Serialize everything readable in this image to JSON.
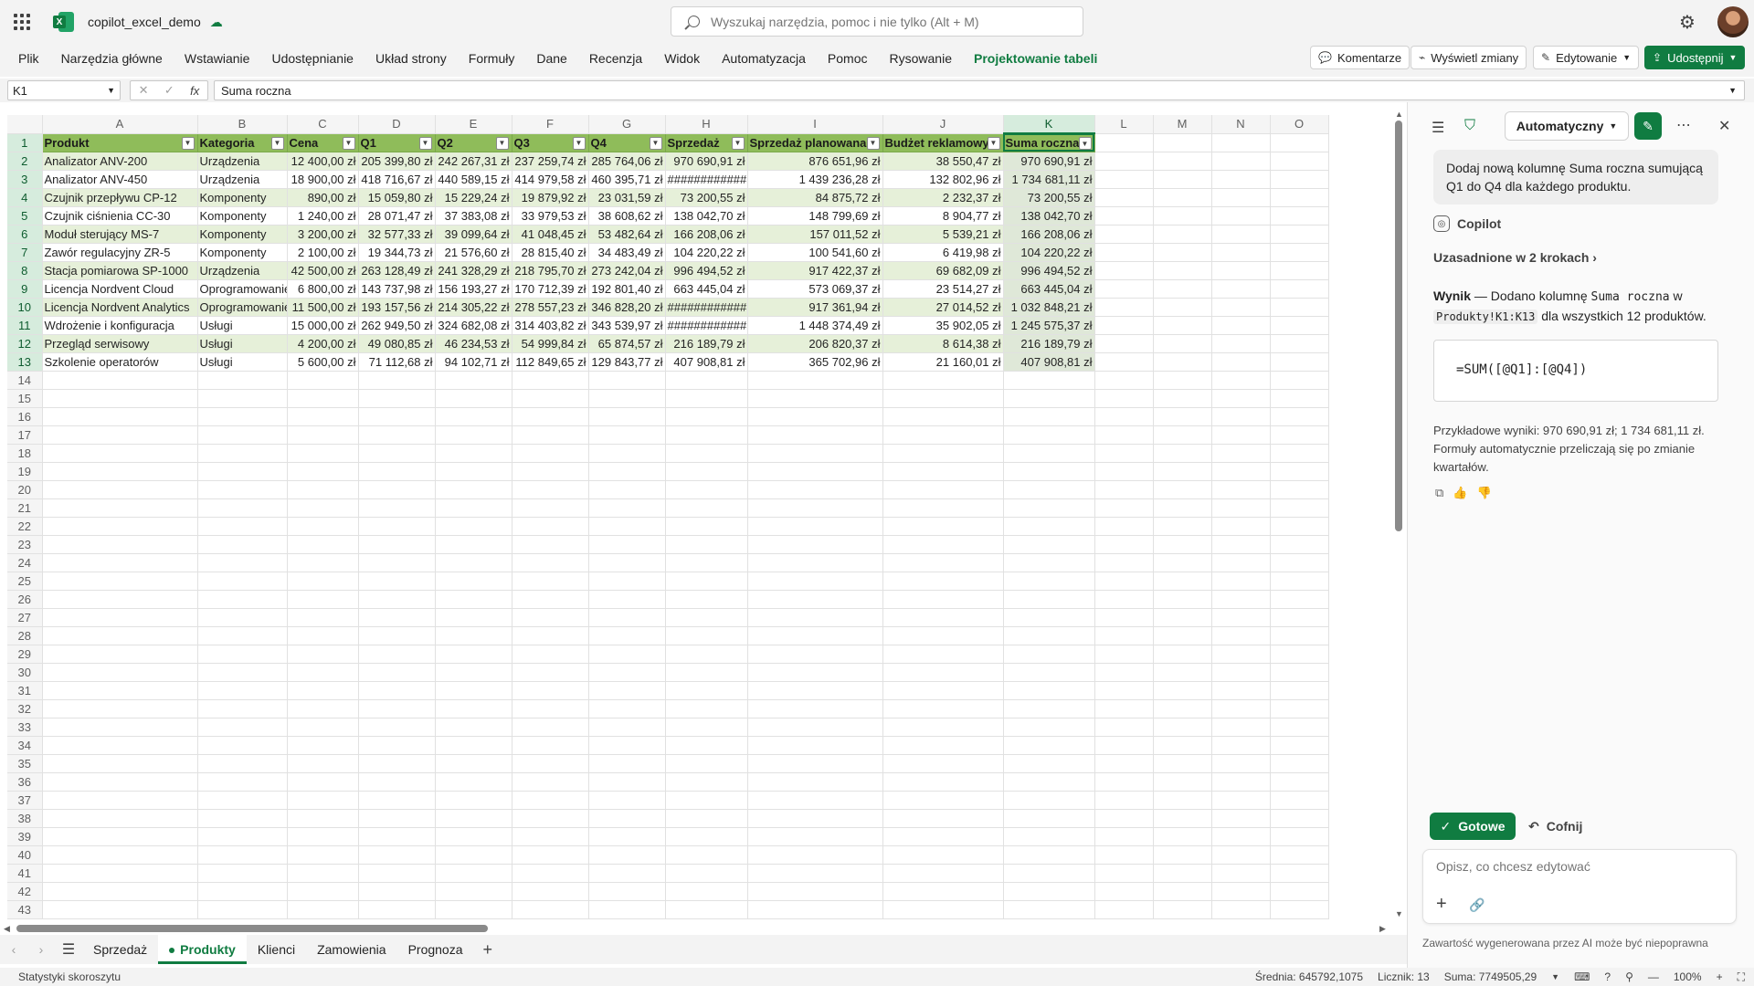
{
  "app": {
    "doc_title": "copilot_excel_demo",
    "search_placeholder": "Wyszukaj narzędzia, pomoc i nie tylko (Alt + M)"
  },
  "ribbon": {
    "tabs": [
      "Plik",
      "Narzędzia główne",
      "Wstawianie",
      "Udostępnianie",
      "Układ strony",
      "Formuły",
      "Dane",
      "Recenzja",
      "Widok",
      "Automatyzacja",
      "Pomoc",
      "Rysowanie",
      "Projektowanie tabeli"
    ],
    "active_tab": "Projektowanie tabeli",
    "comments": "Komentarze",
    "show_changes": "Wyświetl zmiany",
    "editing": "Edytowanie",
    "share": "Udostępnij"
  },
  "formula_bar": {
    "name_box": "K1",
    "fx": "fx",
    "content": "Suma roczna"
  },
  "sheet": {
    "columns": [
      "A",
      "B",
      "C",
      "D",
      "E",
      "F",
      "G",
      "H",
      "I",
      "J",
      "K",
      "L",
      "M",
      "N",
      "O"
    ],
    "selected_column": "K",
    "header": [
      "Produkt",
      "Kategoria",
      "Cena",
      "Q1",
      "Q2",
      "Q3",
      "Q4",
      "Sprzedaż",
      "Sprzedaż planowana",
      "Budżet reklamowy",
      "Suma roczna"
    ],
    "rows": [
      [
        "Analizator ANV-200",
        "Urządzenia",
        "12 400,00 zł",
        "205 399,80 zł",
        "242 267,31 zł",
        "237 259,74 zł",
        "285 764,06 zł",
        "970 690,91 zł",
        "876 651,96 zł",
        "38 550,47 zł",
        "970 690,91 zł"
      ],
      [
        "Analizator ANV-450",
        "Urządzenia",
        "18 900,00 zł",
        "418 716,67 zł",
        "440 589,15 zł",
        "414 979,58 zł",
        "460 395,71 zł",
        "############",
        "1 439 236,28 zł",
        "132 802,96 zł",
        "1 734 681,11 zł"
      ],
      [
        "Czujnik przepływu CP-12",
        "Komponenty",
        "890,00 zł",
        "15 059,80 zł",
        "15 229,24 zł",
        "19 879,92 zł",
        "23 031,59 zł",
        "73 200,55 zł",
        "84 875,72 zł",
        "2 232,37 zł",
        "73 200,55 zł"
      ],
      [
        "Czujnik ciśnienia CC-30",
        "Komponenty",
        "1 240,00 zł",
        "28 071,47 zł",
        "37 383,08 zł",
        "33 979,53 zł",
        "38 608,62 zł",
        "138 042,70 zł",
        "148 799,69 zł",
        "8 904,77 zł",
        "138 042,70 zł"
      ],
      [
        "Moduł sterujący MS-7",
        "Komponenty",
        "3 200,00 zł",
        "32 577,33 zł",
        "39 099,64 zł",
        "41 048,45 zł",
        "53 482,64 zł",
        "166 208,06 zł",
        "157 011,52 zł",
        "5 539,21 zł",
        "166 208,06 zł"
      ],
      [
        "Zawór regulacyjny ZR-5",
        "Komponenty",
        "2 100,00 zł",
        "19 344,73 zł",
        "21 576,60 zł",
        "28 815,40 zł",
        "34 483,49 zł",
        "104 220,22 zł",
        "100 541,60 zł",
        "6 419,98 zł",
        "104 220,22 zł"
      ],
      [
        "Stacja pomiarowa SP-1000",
        "Urządzenia",
        "42 500,00 zł",
        "263 128,49 zł",
        "241 328,29 zł",
        "218 795,70 zł",
        "273 242,04 zł",
        "996 494,52 zł",
        "917 422,37 zł",
        "69 682,09 zł",
        "996 494,52 zł"
      ],
      [
        "Licencja Nordvent Cloud",
        "Oprogramowanie",
        "6 800,00 zł",
        "143 737,98 zł",
        "156 193,27 zł",
        "170 712,39 zł",
        "192 801,40 zł",
        "663 445,04 zł",
        "573 069,37 zł",
        "23 514,27 zł",
        "663 445,04 zł"
      ],
      [
        "Licencja Nordvent Analytics",
        "Oprogramowanie",
        "11 500,00 zł",
        "193 157,56 zł",
        "214 305,22 zł",
        "278 557,23 zł",
        "346 828,20 zł",
        "############",
        "917 361,94 zł",
        "27 014,52 zł",
        "1 032 848,21 zł"
      ],
      [
        "Wdrożenie i konfiguracja",
        "Usługi",
        "15 000,00 zł",
        "262 949,50 zł",
        "324 682,08 zł",
        "314 403,82 zł",
        "343 539,97 zł",
        "############",
        "1 448 374,49 zł",
        "35 902,05 zł",
        "1 245 575,37 zł"
      ],
      [
        "Przegląd serwisowy",
        "Usługi",
        "4 200,00 zł",
        "49 080,85 zł",
        "46 234,53 zł",
        "54 999,84 zł",
        "65 874,57 zł",
        "216 189,79 zł",
        "206 820,37 zł",
        "8 614,38 zł",
        "216 189,79 zł"
      ],
      [
        "Szkolenie operatorów",
        "Usługi",
        "5 600,00 zł",
        "71 112,68 zł",
        "94 102,71 zł",
        "112 849,65 zł",
        "129 843,77 zł",
        "407 908,81 zł",
        "365 702,96 zł",
        "21 160,01 zł",
        "407 908,81 zł"
      ]
    ],
    "row_numbers_total": 43
  },
  "sheet_tabs": {
    "tabs": [
      "Sprzedaż",
      "Produkty",
      "Klienci",
      "Zamowienia",
      "Prognoza"
    ],
    "active": "Produkty"
  },
  "status_bar": {
    "left": "Statystyki skoroszytu",
    "average": "Średnia: 645792,1075",
    "count": "Licznik: 13",
    "sum": "Suma: 7749505,29",
    "zoom": "100%"
  },
  "copilot": {
    "mode": "Automatyczny",
    "user_message": "Dodaj nową kolumnę Suma roczna sumującą Q1 do Q4 dla każdego produktu.",
    "assistant_name": "Copilot",
    "steps_label": "Uzasadnione w 2 krokach",
    "result_prefix": "Wynik",
    "result_text1": " — Dodano kolumnę ",
    "result_col": "Suma roczna",
    "result_text2": " w ",
    "result_range": "Produkty!K1:K13",
    "result_text3": " dla wszystkich 12 produktów.",
    "formula": "=SUM([@Q1]:[@Q4])",
    "example": "Przykładowe wyniki: 970 690,91 zł; 1 734 681,11 zł. Formuły automatycznie przeliczają się po zmianie kwartałów.",
    "done_label": "Gotowe",
    "undo_label": "Cofnij",
    "composer_placeholder": "Opisz, co chcesz edytować",
    "disclaimer": "Zawartość wygenerowana przez AI może być niepoprawna"
  }
}
